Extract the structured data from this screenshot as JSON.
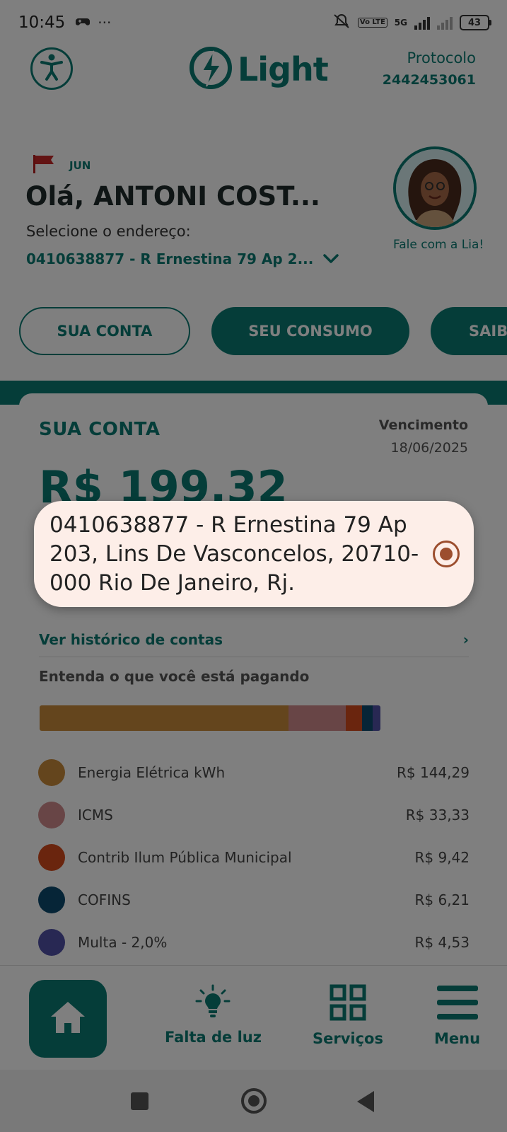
{
  "status_bar": {
    "time": "10:45",
    "network": "5G",
    "lte": "Vo LTE",
    "battery": "43"
  },
  "header": {
    "logo": "Light",
    "protocolo_label": "Protocolo",
    "protocolo_number": "2442453061"
  },
  "greeting": {
    "month": "JUN",
    "text": "Olá, ANTONI COST...",
    "select_label": "Selecione o endereço:",
    "address_short": "0410638877 - R Ernestina 79 Ap 2...",
    "assistant_caption": "Fale com a Lia!"
  },
  "tabs": [
    {
      "label": "SUA CONTA"
    },
    {
      "label": "SEU CONSUMO"
    },
    {
      "label": "SAIBA"
    }
  ],
  "bill": {
    "title": "SUA CONTA",
    "due_label": "Vencimento",
    "due_date": "18/06/2025",
    "amount": "R$ 199,32",
    "history_link": "Ver histórico de contas",
    "explain": "Entenda o que você está pagando",
    "breakdown": [
      {
        "label": "Energia Elétrica kWh",
        "value": "R$ 144,29",
        "amount": 144.29,
        "color": "#c98a3b"
      },
      {
        "label": "ICMS",
        "value": "R$ 33,33",
        "amount": 33.33,
        "color": "#d18a8c"
      },
      {
        "label": "Contrib Ilum Pública Municipal",
        "value": "R$ 9,42",
        "amount": 9.42,
        "color": "#d44b1c"
      },
      {
        "label": "COFINS",
        "value": "R$ 6,21",
        "amount": 6.21,
        "color": "#0d4a6e"
      },
      {
        "label": "Multa  - 2,0%",
        "value": "R$ 4,53",
        "amount": 4.53,
        "color": "#5050a6"
      }
    ]
  },
  "bottom_nav": {
    "falta_de_luz": "Falta de luz",
    "servicos": "Serviços",
    "menu": "Menu"
  },
  "popup": {
    "option_text": "0410638877 - R Ernestina 79 Ap 203, Lins De Vasconcelos, 20710-000 Rio De Janeiro, Rj."
  },
  "colors": {
    "primary": "#0b7b73",
    "popup_bg": "#fdeee8",
    "radio": "#9c4e2e"
  }
}
